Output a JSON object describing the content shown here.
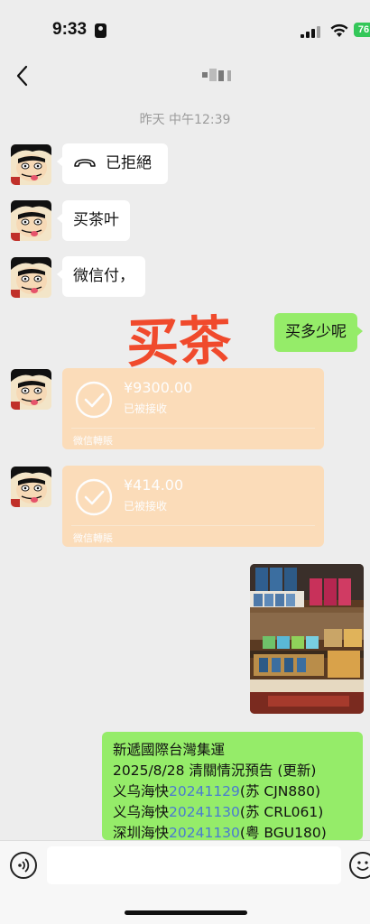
{
  "status_bar": {
    "time": "9:33",
    "battery": "76"
  },
  "timestamp": "昨天 中午12:39",
  "messages": {
    "call_declined": "已拒絕",
    "buy_tea": "买茶叶",
    "wechat_pay": "微信付，",
    "how_much": "买多少呢"
  },
  "overlay_text": "买茶",
  "transfers": [
    {
      "amount": "¥9300.00",
      "status": "已被接收",
      "footer": "微信轉賬"
    },
    {
      "amount": "¥414.00",
      "status": "已被接收",
      "footer": "微信轉賬"
    }
  ],
  "shipping": {
    "line1": "新遞國際台灣集運",
    "line2": "2025/8/28 清關情況預告 (更新)",
    "line3_prefix": "义乌海快",
    "line3_date": "20241129",
    "line3_suffix": "(苏 CJN880)",
    "line4_prefix": "义乌海快",
    "line4_date": "20241130",
    "line4_suffix": "(苏 CRL061)",
    "line5_prefix": "深圳海快",
    "line5_date": "20241130",
    "line5_suffix": "(粤 BGU180)"
  },
  "colors": {
    "green_bubble": "#95ec69",
    "transfer_card": "#fddbb4",
    "overlay_red": "#f04a2c",
    "link_blue": "#4a7bd0"
  },
  "icons": [
    "back-icon",
    "phone-declined-icon",
    "check-circle-icon",
    "voice-icon",
    "emoji-icon"
  ]
}
